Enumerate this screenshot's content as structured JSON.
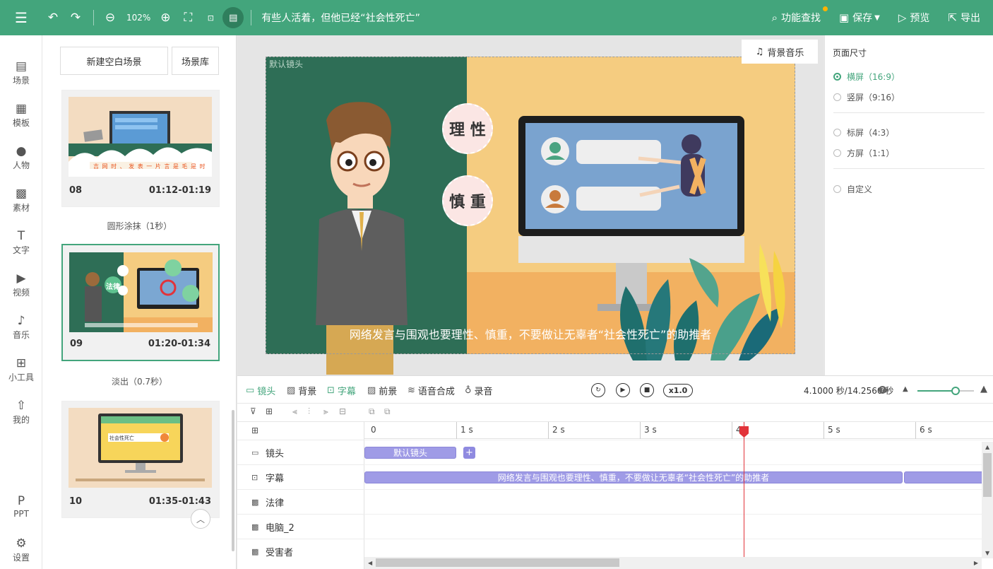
{
  "topbar": {
    "zoom": "102%",
    "title": "有些人活着，但他已经“社会性死亡”",
    "actions": [
      {
        "icon": "search-icon",
        "label": "功能查找"
      },
      {
        "icon": "save-icon",
        "label": "保存"
      },
      {
        "icon": "preview-icon",
        "label": "预览"
      },
      {
        "icon": "export-icon",
        "label": "导出"
      }
    ]
  },
  "nav": [
    {
      "icon": "scene-icon",
      "label": "场景"
    },
    {
      "icon": "template-icon",
      "label": "模板"
    },
    {
      "icon": "person-icon",
      "label": "人物"
    },
    {
      "icon": "material-icon",
      "label": "素材"
    },
    {
      "icon": "text-icon",
      "label": "文字"
    },
    {
      "icon": "video-icon",
      "label": "视频"
    },
    {
      "icon": "music-icon",
      "label": "音乐"
    },
    {
      "icon": "toolbox-icon",
      "label": "小工具"
    },
    {
      "icon": "mine-icon",
      "label": "我的"
    },
    {
      "icon": "ppt-icon",
      "label": "PPT"
    },
    {
      "icon": "settings-icon",
      "label": "设置"
    }
  ],
  "scenes": {
    "new_blank": "新建空白场景",
    "library": "场景库",
    "cards": [
      {
        "num": "08",
        "time": "01:12-01:19",
        "transition": "圆形涂抹（1秒）",
        "thumb_caption": "吉 网 时 、 发 表 一 片 言 是 毛 是 时"
      },
      {
        "num": "09",
        "time": "01:20-01:34",
        "transition": "淡出（0.7秒）",
        "thumb_bubble": "法律"
      },
      {
        "num": "10",
        "time": "01:35-01:43",
        "transition": "",
        "thumb_search": "社会性死亡"
      }
    ]
  },
  "canvas": {
    "camera_label": "默认镜头",
    "bgm": "背景音乐",
    "bubble_top": "理 性",
    "bubble_bottom": "慎 重",
    "subtitle": "网络发言与围观也要理性、慎重，不要做让无辜者“社会性死亡”的助推者"
  },
  "page_size": {
    "title": "页面尺寸",
    "options": [
      {
        "label": "横屏（16:9）",
        "selected": true
      },
      {
        "label": "竖屏（9:16）",
        "selected": false
      },
      {
        "label": "标屏（4:3）",
        "selected": false
      },
      {
        "label": "方屏（1:1）",
        "selected": false
      },
      {
        "label": "自定义",
        "selected": false
      }
    ]
  },
  "timeline_toolbar": {
    "tabs": [
      {
        "icon": "camera-icon",
        "label": "镜头",
        "active": true
      },
      {
        "icon": "background-icon",
        "label": "背景",
        "active": false
      },
      {
        "icon": "subtitle-icon",
        "label": "字幕",
        "active": true
      },
      {
        "icon": "foreground-icon",
        "label": "前景",
        "active": false
      },
      {
        "icon": "voice-synthesis-icon",
        "label": "语音合成",
        "active": false
      },
      {
        "icon": "microphone-icon",
        "label": "录音",
        "active": false
      }
    ],
    "speed": "x1.0",
    "timecode": "4.1000 秒/14.2560 秒",
    "zoom_level": 0.68
  },
  "timeline": {
    "ticks": [
      "0",
      "1 s",
      "2 s",
      "3 s",
      "4 s",
      "5 s",
      "6 s"
    ],
    "playhead_seconds": 4.1,
    "tracks": [
      {
        "icon": "camera-icon",
        "label": "镜头"
      },
      {
        "icon": "subtitle-icon",
        "label": "字幕"
      },
      {
        "icon": "character-icon",
        "label": "法律"
      },
      {
        "icon": "character-icon",
        "label": "电脑_2"
      },
      {
        "icon": "character-icon",
        "label": "受害者"
      }
    ],
    "camera_clip": "默认镜头",
    "add_clip": "+",
    "subtitle_clip": "网络发言与围观也要理性、慎重，不要做让无辜者“社会性死亡”的助推者"
  }
}
